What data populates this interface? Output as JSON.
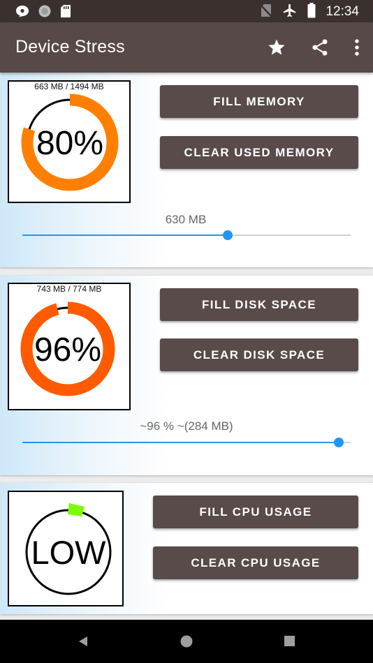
{
  "status_bar": {
    "time": "12:34",
    "left_icons": [
      "chat-bubble-icon",
      "record-circle-icon",
      "sd-card-icon"
    ],
    "right_icons": [
      "no-sim-icon",
      "airplane-mode-icon",
      "battery-icon"
    ]
  },
  "app_bar": {
    "title": "Device Stress",
    "actions": [
      "star-icon",
      "share-icon",
      "more-vert-icon"
    ]
  },
  "memory_card": {
    "gauge_caption": "663 MB / 1494 MB",
    "gauge_value": "80%",
    "gauge_fraction": 0.8,
    "gauge_color": "#ff8000",
    "fill_button": "FILL MEMORY",
    "clear_button": "CLEAR USED MEMORY",
    "slider_label": "630 MB",
    "slider_fraction": 0.625
  },
  "disk_card": {
    "gauge_caption": "743 MB / 774 MB",
    "gauge_value": "96%",
    "gauge_fraction": 0.96,
    "gauge_color": "#ff5a00",
    "fill_button": "FILL DISK SPACE",
    "clear_button": "CLEAR DISK SPACE",
    "slider_label": "~96 % ~(284 MB)",
    "slider_fraction": 0.964
  },
  "cpu_card": {
    "gauge_value": "LOW",
    "gauge_color": "#7cfc00",
    "fill_button": "FILL CPU USAGE",
    "clear_button": "CLEAR CPU USAGE"
  },
  "nav_bar": {
    "buttons": [
      "back-icon",
      "home-icon",
      "recents-icon"
    ]
  },
  "colors": {
    "status_bar": "#3a312f",
    "app_bar": "#574947",
    "button": "#584b49",
    "slider_accent": "#2196f3"
  }
}
